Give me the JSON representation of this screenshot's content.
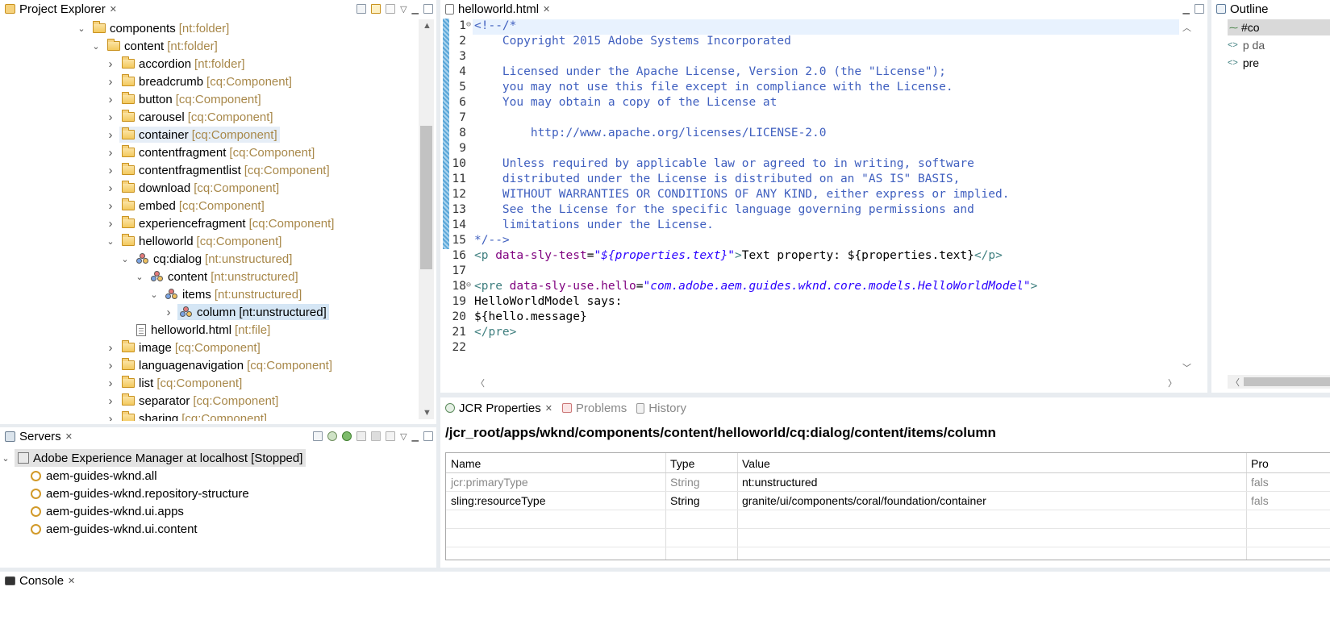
{
  "project_explorer": {
    "title": "Project Explorer",
    "tree": [
      {
        "label": "components",
        "type": "[nt:folder]",
        "icon": "folder-icon",
        "depth": 0,
        "chevron": "expanded"
      },
      {
        "label": "content",
        "type": "[nt:folder]",
        "icon": "folder-icon",
        "depth": 1,
        "chevron": "expanded"
      },
      {
        "label": "accordion",
        "type": "[nt:folder]",
        "icon": "folder-icon",
        "depth": 2,
        "chevron": "collapsed"
      },
      {
        "label": "breadcrumb",
        "type": "[cq:Component]",
        "icon": "folder-icon",
        "depth": 2,
        "chevron": "collapsed"
      },
      {
        "label": "button",
        "type": "[cq:Component]",
        "icon": "folder-icon",
        "depth": 2,
        "chevron": "collapsed"
      },
      {
        "label": "carousel",
        "type": "[cq:Component]",
        "icon": "folder-icon",
        "depth": 2,
        "chevron": "collapsed"
      },
      {
        "label": "container",
        "type": "[cq:Component]",
        "icon": "folder-icon",
        "depth": 2,
        "chevron": "collapsed",
        "state": "hover"
      },
      {
        "label": "contentfragment",
        "type": "[cq:Component]",
        "icon": "folder-icon",
        "depth": 2,
        "chevron": "collapsed"
      },
      {
        "label": "contentfragmentlist",
        "type": "[cq:Component]",
        "icon": "folder-icon",
        "depth": 2,
        "chevron": "collapsed"
      },
      {
        "label": "download",
        "type": "[cq:Component]",
        "icon": "folder-icon",
        "depth": 2,
        "chevron": "collapsed"
      },
      {
        "label": "embed",
        "type": "[cq:Component]",
        "icon": "folder-icon",
        "depth": 2,
        "chevron": "collapsed"
      },
      {
        "label": "experiencefragment",
        "type": "[cq:Component]",
        "icon": "folder-icon",
        "depth": 2,
        "chevron": "collapsed"
      },
      {
        "label": "helloworld",
        "type": "[cq:Component]",
        "icon": "folder-icon",
        "depth": 2,
        "chevron": "expanded"
      },
      {
        "label": "cq:dialog",
        "type": "[nt:unstructured]",
        "icon": "node-icon",
        "depth": 3,
        "chevron": "expanded"
      },
      {
        "label": "content",
        "type": "[nt:unstructured]",
        "icon": "node-icon",
        "depth": 4,
        "chevron": "expanded"
      },
      {
        "label": "items",
        "type": "[nt:unstructured]",
        "icon": "node-icon",
        "depth": 5,
        "chevron": "expanded"
      },
      {
        "label": "column",
        "type": "[nt:unstructured]",
        "icon": "node-icon",
        "depth": 6,
        "chevron": "collapsed",
        "state": "selected"
      },
      {
        "label": "helloworld.html",
        "type": "[nt:file]",
        "icon": "file-icon",
        "depth": 3,
        "chevron": "none"
      },
      {
        "label": "image",
        "type": "[cq:Component]",
        "icon": "folder-icon",
        "depth": 2,
        "chevron": "collapsed"
      },
      {
        "label": "languagenavigation",
        "type": "[cq:Component]",
        "icon": "folder-icon",
        "depth": 2,
        "chevron": "collapsed"
      },
      {
        "label": "list",
        "type": "[cq:Component]",
        "icon": "folder-icon",
        "depth": 2,
        "chevron": "collapsed"
      },
      {
        "label": "separator",
        "type": "[cq:Component]",
        "icon": "folder-icon",
        "depth": 2,
        "chevron": "collapsed"
      },
      {
        "label": "sharing",
        "type": "[cq:Component]",
        "icon": "folder-icon",
        "depth": 2,
        "chevron": "collapsed"
      }
    ]
  },
  "editor": {
    "tab_label": "helloworld.html",
    "lines": [
      {
        "n": "1",
        "fold": true,
        "parts": [
          [
            "cm",
            "<!--/*"
          ]
        ]
      },
      {
        "n": "2",
        "parts": [
          [
            "cm",
            "    Copyright 2015 Adobe Systems Incorporated"
          ]
        ]
      },
      {
        "n": "3",
        "parts": [
          [
            "cm",
            ""
          ]
        ]
      },
      {
        "n": "4",
        "parts": [
          [
            "cm",
            "    Licensed under the Apache License, Version 2.0 (the \"License\");"
          ]
        ]
      },
      {
        "n": "5",
        "parts": [
          [
            "cm",
            "    you may not use this file except in compliance with the License."
          ]
        ]
      },
      {
        "n": "6",
        "parts": [
          [
            "cm",
            "    You may obtain a copy of the License at"
          ]
        ]
      },
      {
        "n": "7",
        "parts": [
          [
            "cm",
            ""
          ]
        ]
      },
      {
        "n": "8",
        "parts": [
          [
            "cm",
            "        http://www.apache.org/licenses/LICENSE-2.0"
          ]
        ]
      },
      {
        "n": "9",
        "parts": [
          [
            "cm",
            ""
          ]
        ]
      },
      {
        "n": "10",
        "parts": [
          [
            "cm",
            "    Unless required by applicable law or agreed to in writing, software"
          ]
        ]
      },
      {
        "n": "11",
        "parts": [
          [
            "cm",
            "    distributed under the License is distributed on an \"AS IS\" BASIS,"
          ]
        ]
      },
      {
        "n": "12",
        "parts": [
          [
            "cm",
            "    WITHOUT WARRANTIES OR CONDITIONS OF ANY KIND, either express or implied."
          ]
        ]
      },
      {
        "n": "13",
        "parts": [
          [
            "cm",
            "    See the License for the specific language governing permissions and"
          ]
        ]
      },
      {
        "n": "14",
        "parts": [
          [
            "cm",
            "    limitations under the License."
          ]
        ]
      },
      {
        "n": "15",
        "parts": [
          [
            "cm",
            "*/-->"
          ]
        ]
      },
      {
        "n": "16",
        "parts": [
          [
            "tg",
            "<p "
          ],
          [
            "at",
            "data-sly-test"
          ],
          [
            "tx",
            "="
          ],
          [
            "av",
            "\"${properties.text}\""
          ],
          [
            "tg",
            ">"
          ],
          [
            "tx",
            "Text property: ${properties.text}"
          ],
          [
            "tg",
            "</p>"
          ]
        ]
      },
      {
        "n": "17",
        "parts": [
          [
            "tx",
            ""
          ]
        ]
      },
      {
        "n": "18",
        "fold": true,
        "parts": [
          [
            "tg",
            "<pre "
          ],
          [
            "at",
            "data-sly-use.hello"
          ],
          [
            "tx",
            "="
          ],
          [
            "av",
            "\"com.adobe.aem.guides.wknd.core.models.HelloWorldModel\""
          ],
          [
            "tg",
            ">"
          ]
        ]
      },
      {
        "n": "19",
        "parts": [
          [
            "tx",
            "HelloWorldModel says:"
          ]
        ]
      },
      {
        "n": "20",
        "parts": [
          [
            "tx",
            "${hello.message}"
          ]
        ]
      },
      {
        "n": "21",
        "parts": [
          [
            "tg",
            "</pre>"
          ]
        ]
      },
      {
        "n": "22",
        "parts": [
          [
            "tx",
            ""
          ]
        ]
      }
    ]
  },
  "outline": {
    "title": "Outline",
    "items": [
      {
        "label": "#co"
      },
      {
        "label": "p da"
      },
      {
        "label": "pre"
      }
    ]
  },
  "servers": {
    "title": "Servers",
    "server": "Adobe Experience Manager at localhost  [Stopped]",
    "modules": [
      "aem-guides-wknd.all",
      "aem-guides-wknd.repository-structure",
      "aem-guides-wknd.ui.apps",
      "aem-guides-wknd.ui.content"
    ]
  },
  "jcr": {
    "tabs": [
      "JCR Properties",
      "Problems",
      "History"
    ],
    "path": "/jcr_root/apps/wknd/components/content/helloworld/cq:dialog/content/items/column",
    "columns": [
      "Name",
      "Type",
      "Value",
      "Pro"
    ],
    "rows": [
      {
        "name": "jcr:primaryType",
        "type": "String",
        "value": "nt:unstructured",
        "pro": "fals",
        "muted": true
      },
      {
        "name": "sling:resourceType",
        "type": "String",
        "value": "granite/ui/components/coral/foundation/container",
        "pro": "fals",
        "muted": false
      }
    ]
  },
  "console": {
    "title": "Console"
  }
}
